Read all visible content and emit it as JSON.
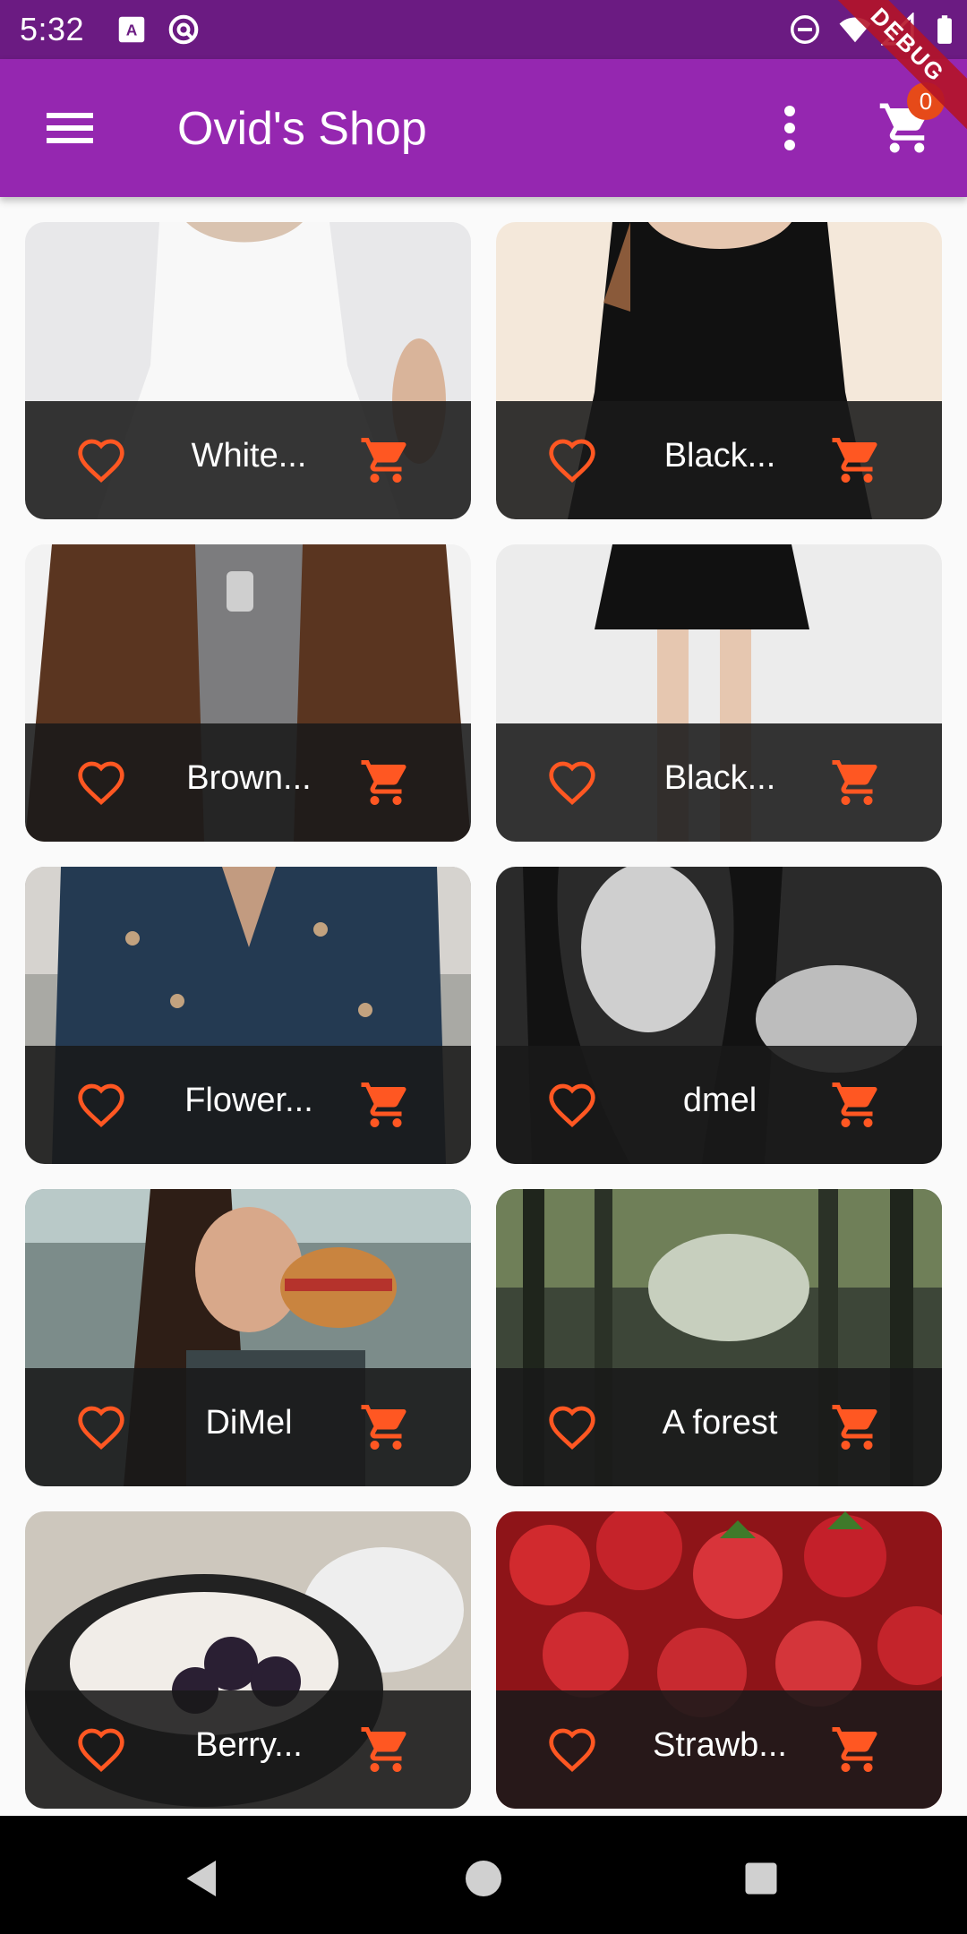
{
  "status_bar": {
    "time": "5:32",
    "left_icons": [
      "a-notification-icon",
      "at-sign-icon"
    ],
    "right_icons": [
      "do-not-disturb-icon",
      "wifi-icon",
      "signal-icon",
      "battery-icon"
    ]
  },
  "debug_ribbon": {
    "label": "DEBUG"
  },
  "app_bar": {
    "title": "Ovid's Shop",
    "cart_badge": "0",
    "menu_icon": "menu-icon",
    "more_icon": "more-vert-icon",
    "cart_icon": "shopping-cart-icon"
  },
  "colors": {
    "status_bar": "#6b1b82",
    "app_bar": "#9527b0",
    "accent": "#ff5722",
    "card_footer": "#191919"
  },
  "products": [
    {
      "title": "White...",
      "image": "white-dress"
    },
    {
      "title": "Black...",
      "image": "black-dress"
    },
    {
      "title": "Brown...",
      "image": "brown-jacket"
    },
    {
      "title": "Black...",
      "image": "black-skirt"
    },
    {
      "title": "Flower...",
      "image": "flower-shirt"
    },
    {
      "title": "dmel",
      "image": "woman-portrait"
    },
    {
      "title": "DiMel",
      "image": "woman-burger"
    },
    {
      "title": "A forest",
      "image": "forest"
    },
    {
      "title": "Berry...",
      "image": "berry-bowl"
    },
    {
      "title": "Strawb...",
      "image": "strawberries"
    }
  ],
  "nav_bar": {
    "back_icon": "back-icon",
    "home_icon": "home-icon",
    "recents_icon": "recents-icon"
  }
}
